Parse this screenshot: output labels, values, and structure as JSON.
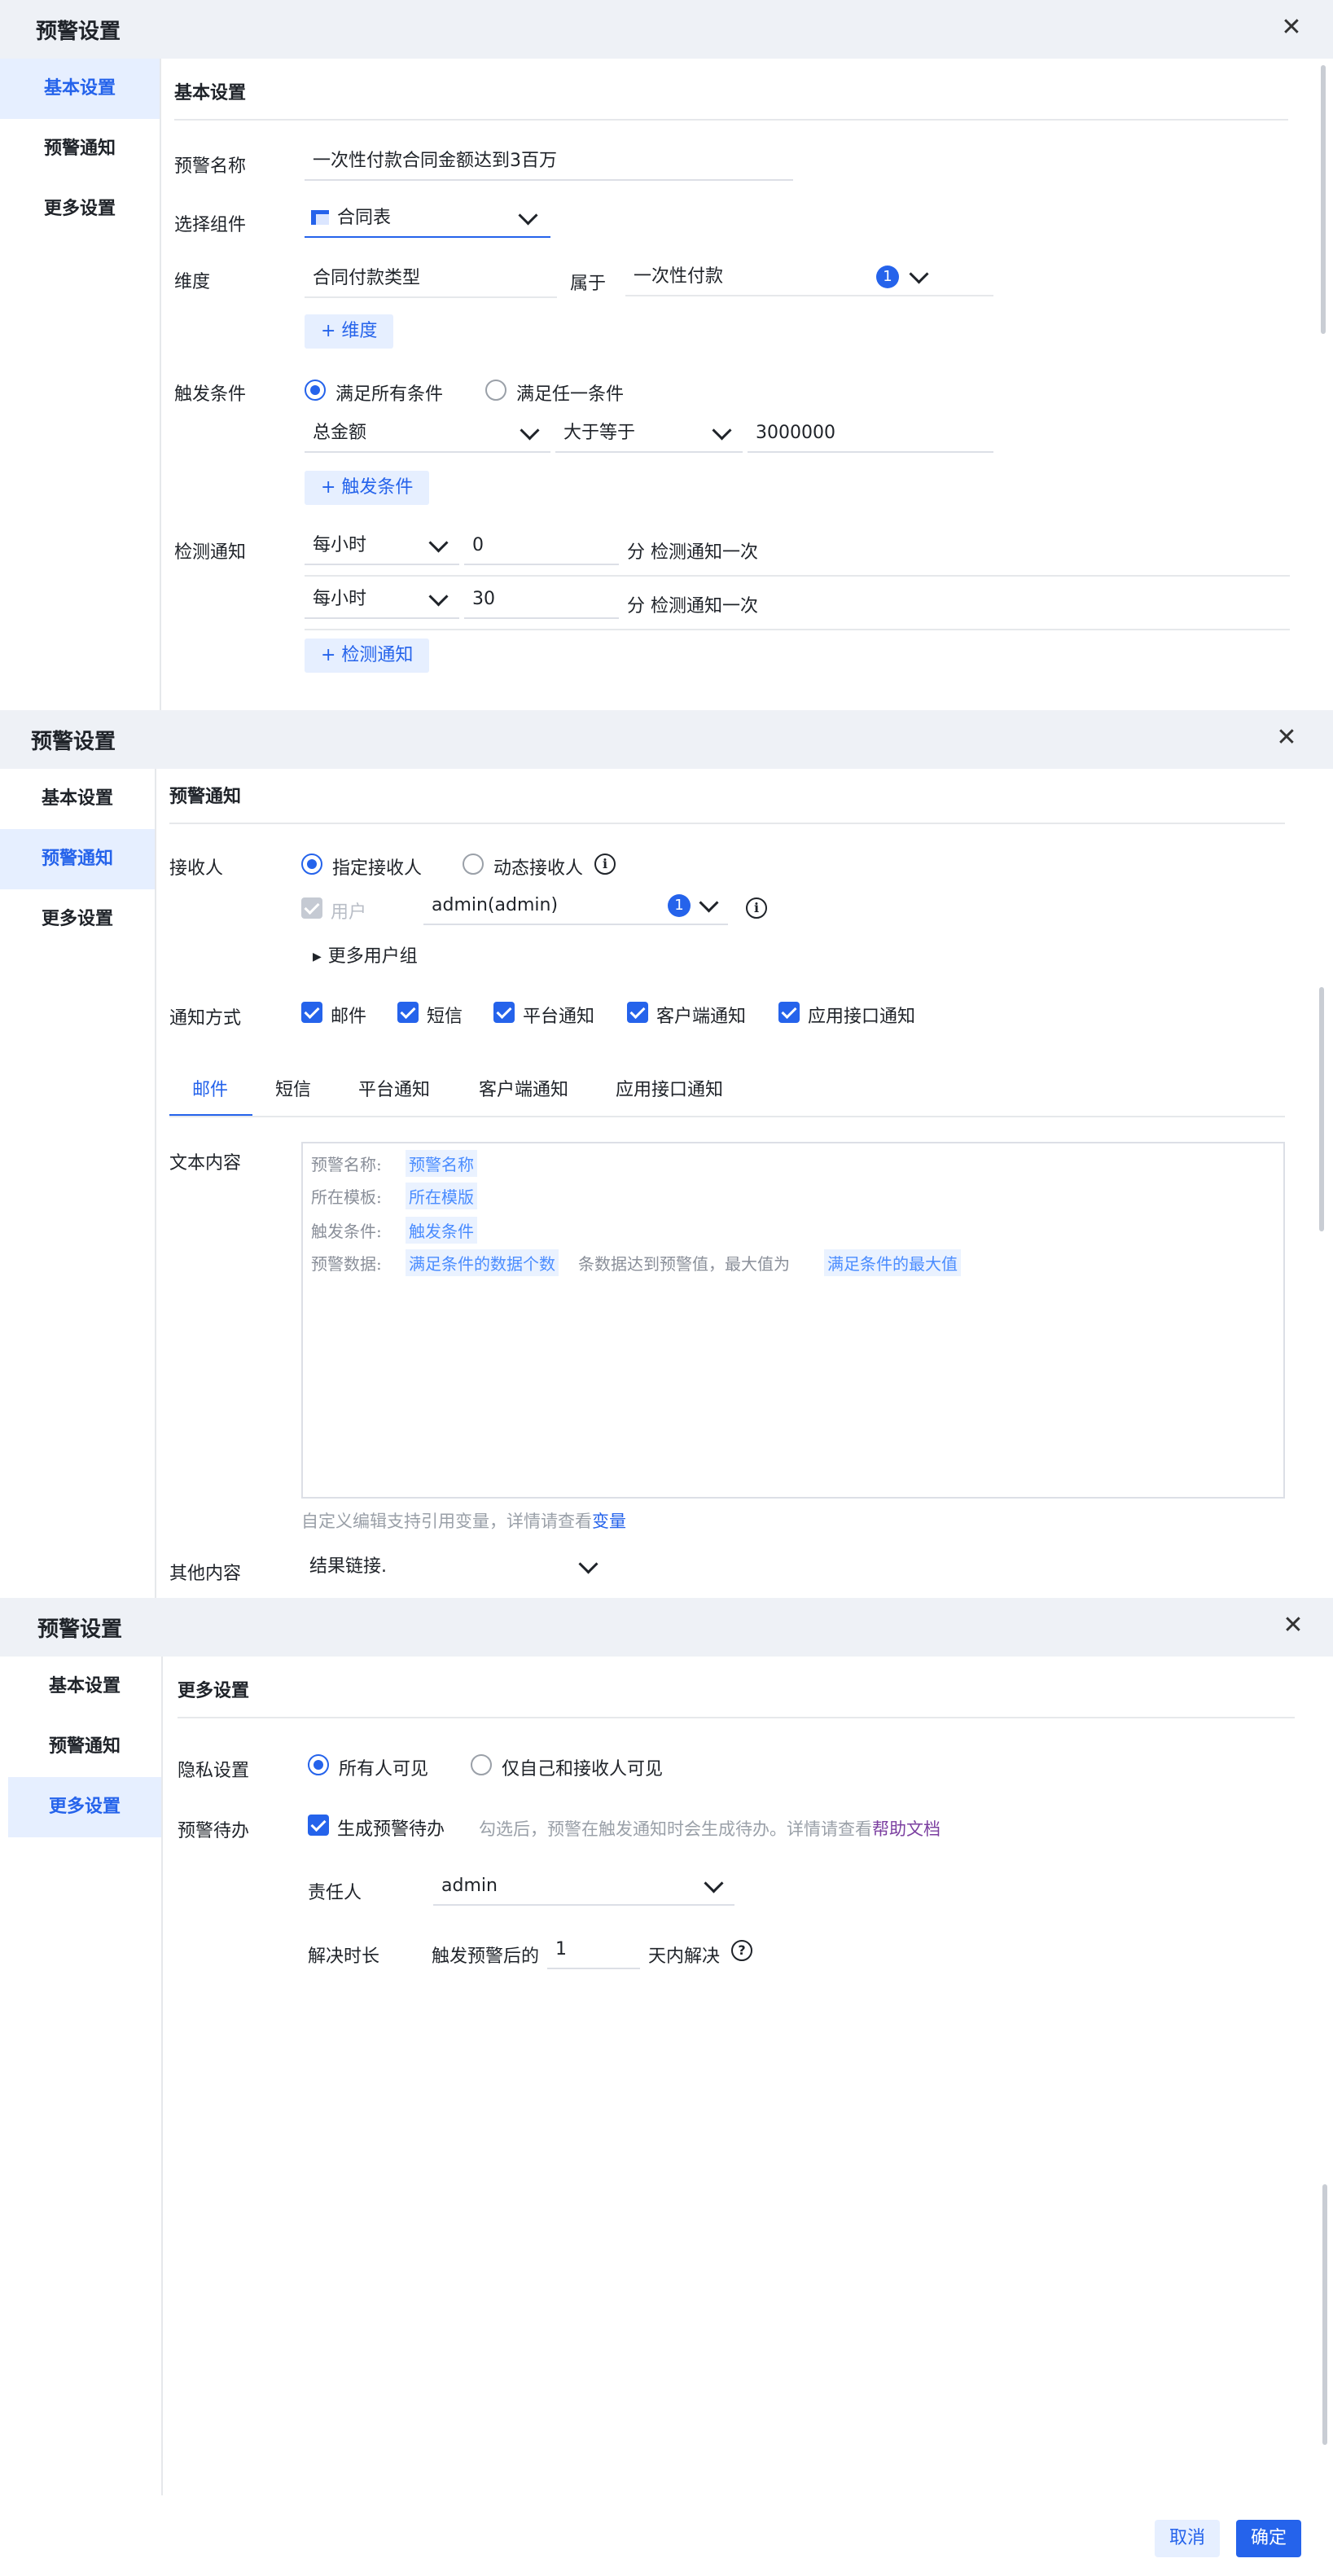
{
  "dialog_title": "预警设置",
  "nav": [
    "基本设置",
    "预警通知",
    "更多设置"
  ],
  "basic": {
    "section_title": "基本设置",
    "name_label": "预警名称",
    "name_value": "一次性付款合同金额达到3百万",
    "component_label": "选择组件",
    "component_value": "合同表",
    "dimension_label": "维度",
    "dimension_field": "合同付款类型",
    "belongs_label": "属于",
    "belongs_value": "一次性付款",
    "belongs_count": "1",
    "add_dimension": "+ 维度",
    "trigger_label": "触发条件",
    "trigger_options": [
      "满足所有条件",
      "满足任一条件"
    ],
    "trigger_field": "总金额",
    "trigger_operator": "大于等于",
    "trigger_value": "3000000",
    "add_trigger": "+ 触发条件",
    "check_label": "检测通知",
    "check_rows": [
      {
        "freq": "每小时",
        "minute": "0",
        "suffix": "分 检测通知一次"
      },
      {
        "freq": "每小时",
        "minute": "30",
        "suffix": "分 检测通知一次"
      }
    ],
    "add_check": "+ 检测通知"
  },
  "notify": {
    "section_title": "预警通知",
    "receiver_label": "接收人",
    "receiver_options": [
      "指定接收人",
      "动态接收人"
    ],
    "user_label": "用户",
    "user_value": "admin(admin)",
    "user_count": "1",
    "more_groups": "更多用户组",
    "method_label": "通知方式",
    "methods": [
      "邮件",
      "短信",
      "平台通知",
      "客户端通知",
      "应用接口通知"
    ],
    "tabs": [
      "邮件",
      "短信",
      "平台通知",
      "客户端通知",
      "应用接口通知"
    ],
    "text_label": "文本内容",
    "lines": [
      {
        "label": "预警名称:",
        "tag": "预警名称"
      },
      {
        "label": "所在模板:",
        "tag": "所在模版"
      },
      {
        "label": "触发条件:",
        "tag": "触发条件"
      }
    ],
    "data_line": {
      "label": "预警数据:",
      "tag1": "满足条件的数据个数",
      "mid": "条数据达到预警值，最大值为",
      "tag2": "满足条件的最大值"
    },
    "hint_prefix": "自定义编辑支持引用变量，详情请查看",
    "hint_link": "变量",
    "other_label": "其他内容",
    "other_value": "结果链接."
  },
  "more": {
    "section_title": "更多设置",
    "privacy_label": "隐私设置",
    "privacy_options": [
      "所有人可见",
      "仅自己和接收人可见"
    ],
    "todo_label": "预警待办",
    "todo_check": "生成预警待办",
    "todo_hint": "勾选后，预警在触发通知时会生成待办。详情请查看",
    "todo_link": "帮助文档",
    "owner_label": "责任人",
    "owner_value": "admin",
    "duration_label": "解决时长",
    "duration_prefix": "触发预警后的",
    "duration_value": "1",
    "duration_suffix": "天内解决"
  },
  "footer": {
    "cancel": "取消",
    "ok": "确定"
  },
  "colors": {
    "accent": "#2563eb",
    "accent_light": "#e6efff",
    "title_bg": "#eef1f6"
  }
}
